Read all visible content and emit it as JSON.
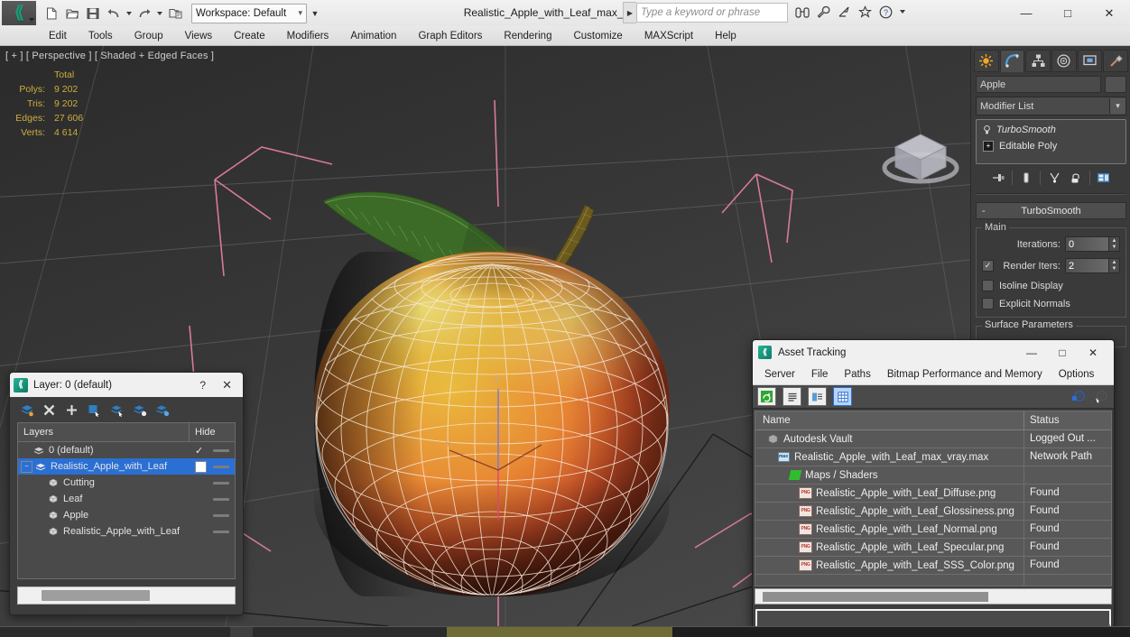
{
  "titlebar": {
    "app_logo": "3dsmax-logo-icon",
    "quick_access": [
      {
        "name": "new-file-button",
        "icon": "new-file-icon",
        "glyph": "❐"
      },
      {
        "name": "open-file-button",
        "icon": "open-folder-icon",
        "glyph": "Ὄ2"
      },
      {
        "name": "save-file-button",
        "icon": "save-disk-icon",
        "glyph": "ὋE"
      },
      {
        "name": "undo-button",
        "icon": "undo-arrow-icon",
        "glyph": "↶"
      },
      {
        "name": "redo-button",
        "icon": "redo-arrow-icon",
        "glyph": "↷"
      },
      {
        "name": "set-project-folder-button",
        "icon": "project-folder-icon",
        "glyph": "὜2"
      }
    ],
    "workspace_label": "Workspace: Default",
    "document_title": "Realistic_Apple_with_Leaf_max_vray.max",
    "search_placeholder": "Type a keyword or phrase",
    "help_icons": [
      "binoculars-icon",
      "wrench-icon",
      "satellite-icon",
      "star-icon",
      "help-question-icon"
    ],
    "window_buttons": {
      "minimize": "—",
      "maximize": "□",
      "close": "✕"
    }
  },
  "menubar": {
    "items": [
      "Edit",
      "Tools",
      "Group",
      "Views",
      "Create",
      "Modifiers",
      "Animation",
      "Graph Editors",
      "Rendering",
      "Customize",
      "MAXScript",
      "Help"
    ]
  },
  "viewport": {
    "label": "[ + ] [ Perspective ] [ Shaded + Edged Faces ]",
    "stats": {
      "header": "Total",
      "rows": [
        {
          "label": "Polys:",
          "value": "9 202"
        },
        {
          "label": "Tris:",
          "value": "9 202"
        },
        {
          "label": "Edges:",
          "value": "27 606"
        },
        {
          "label": "Verts:",
          "value": "4 614"
        }
      ]
    },
    "viewcube": "view-cube",
    "scene_object": "realistic-apple-with-leaf"
  },
  "command_panel": {
    "tabs": [
      {
        "name": "create-tab",
        "icon": "create-star-icon",
        "active": false
      },
      {
        "name": "modify-tab",
        "icon": "modify-arc-icon",
        "active": true
      },
      {
        "name": "hierarchy-tab",
        "icon": "hierarchy-icon",
        "active": false
      },
      {
        "name": "motion-tab",
        "icon": "motion-wheel-icon",
        "active": false
      },
      {
        "name": "display-tab",
        "icon": "display-monitor-icon",
        "active": false
      },
      {
        "name": "utilities-tab",
        "icon": "hammer-icon",
        "active": false
      }
    ],
    "object_name": "Apple",
    "modifier_list_label": "Modifier List",
    "modifier_stack": [
      {
        "name": "TurboSmooth",
        "icon": "lightbulb-icon",
        "italic": true
      },
      {
        "name": "Editable Poly",
        "icon": "plus-box-icon",
        "italic": false
      }
    ],
    "stack_tools": [
      "pin-stack-icon",
      "show-end-result-icon",
      "make-unique-icon",
      "remove-modifier-icon",
      "configure-sets-icon"
    ],
    "rollout": {
      "title": "TurboSmooth",
      "collapse_glyph": "-",
      "main_group": "Main",
      "iterations_label": "Iterations:",
      "iterations_value": "0",
      "render_iters_label": "Render Iters:",
      "render_iters_value": "2",
      "render_iters_checked": true,
      "isoline_display_label": "Isoline Display",
      "isoline_display_checked": false,
      "explicit_normals_label": "Explicit Normals",
      "explicit_normals_checked": false,
      "surface_parameters_label": "Surface Parameters"
    }
  },
  "layer_dialog": {
    "title": "Layer: 0 (default)",
    "help_glyph": "?",
    "close_glyph": "✕",
    "toolbar": [
      "create-new-layer-icon",
      "delete-layer-icon",
      "add-layer-icon",
      "select-objects-in-layer-icon",
      "select-highlighted-layer-icon",
      "add-selection-to-layer-icon",
      "set-current-layer-icon"
    ],
    "columns": {
      "name": "Layers",
      "hide": "Hide"
    },
    "rows": [
      {
        "name": "0 (default)",
        "indent": 0,
        "selected": false,
        "expand": false,
        "current": true,
        "hide_mark": "check"
      },
      {
        "name": "Realistic_Apple_with_Leaf",
        "indent": 0,
        "selected": true,
        "expand": true,
        "current": false,
        "hide_mark": "box"
      },
      {
        "name": "Cutting",
        "indent": 1,
        "selected": false,
        "expand": false,
        "current": false,
        "hide_mark": ""
      },
      {
        "name": "Leaf",
        "indent": 1,
        "selected": false,
        "expand": false,
        "current": false,
        "hide_mark": ""
      },
      {
        "name": "Apple",
        "indent": 1,
        "selected": false,
        "expand": false,
        "current": false,
        "hide_mark": ""
      },
      {
        "name": "Realistic_Apple_with_Leaf",
        "indent": 1,
        "selected": false,
        "expand": false,
        "current": false,
        "hide_mark": ""
      }
    ]
  },
  "asset_tracking": {
    "title": "Asset Tracking",
    "window_buttons": {
      "minimize": "—",
      "maximize": "□",
      "close": "✕"
    },
    "menus": [
      "Server",
      "File",
      "Paths",
      "Bitmap Performance and Memory",
      "Options"
    ],
    "toolbar": [
      {
        "name": "refresh-button",
        "icon": "refresh-icon",
        "glyph": "↻",
        "active": false
      },
      {
        "name": "list-view-button",
        "icon": "list-icon",
        "glyph": "☰",
        "active": false
      },
      {
        "name": "details-view-button",
        "icon": "details-icon",
        "glyph": "▦",
        "active": false
      },
      {
        "name": "grid-view-button",
        "icon": "grid-icon",
        "glyph": "▦",
        "active": true
      }
    ],
    "help_icons": [
      "help-info-icon",
      "help-pointer-icon"
    ],
    "columns": {
      "name": "Name",
      "status": "Status"
    },
    "rows": [
      {
        "name": "Autodesk Vault",
        "status": "Logged Out ...",
        "indent": 0,
        "icon": "vault-icon"
      },
      {
        "name": "Realistic_Apple_with_Leaf_max_vray.max",
        "status": "Network Path",
        "indent": 1,
        "icon": "max-file-icon"
      },
      {
        "name": "Maps / Shaders",
        "status": "",
        "indent": 2,
        "icon": "maps-shaders-icon"
      },
      {
        "name": "Realistic_Apple_with_Leaf_Diffuse.png",
        "status": "Found",
        "indent": 3,
        "icon": "png-file-icon"
      },
      {
        "name": "Realistic_Apple_with_Leaf_Glossiness.png",
        "status": "Found",
        "indent": 3,
        "icon": "png-file-icon"
      },
      {
        "name": "Realistic_Apple_with_Leaf_Normal.png",
        "status": "Found",
        "indent": 3,
        "icon": "png-file-icon"
      },
      {
        "name": "Realistic_Apple_with_Leaf_Specular.png",
        "status": "Found",
        "indent": 3,
        "icon": "png-file-icon"
      },
      {
        "name": "Realistic_Apple_with_Leaf_SSS_Color.png",
        "status": "Found",
        "indent": 3,
        "icon": "png-file-icon"
      }
    ]
  },
  "colors": {
    "accent_blue": "#2a6fd4",
    "viewport_bg": "#3a3a3a",
    "panel_bg": "#3d3d3d",
    "stats_text": "#cfae3d",
    "helper_pink": "#d87a9a",
    "apple_red": "#d9542b",
    "apple_yellow": "#e8df78",
    "leaf_green": "#3f6b2a"
  }
}
